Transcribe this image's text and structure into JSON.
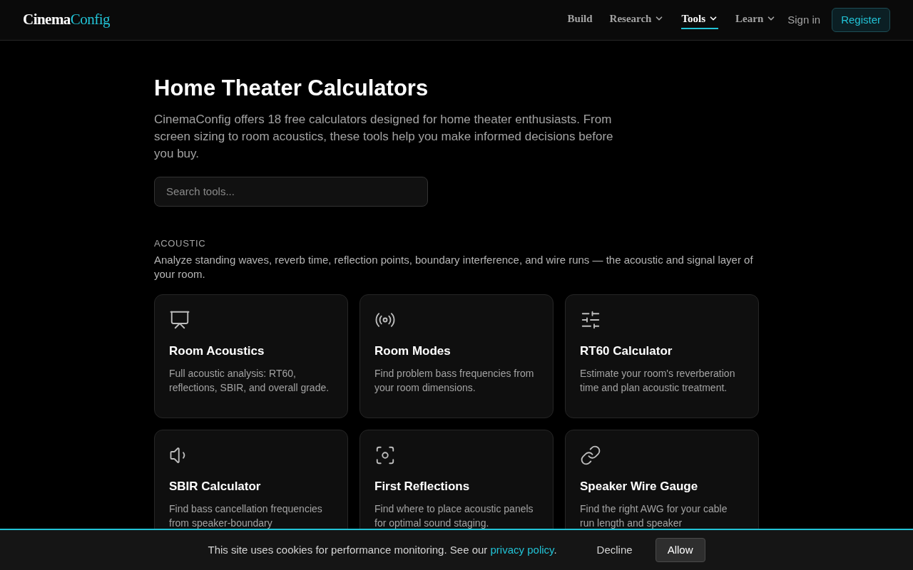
{
  "header": {
    "logo": {
      "part_1": "Cinema",
      "part_2": "Config"
    },
    "nav": [
      {
        "label": "Build",
        "dropdown": false,
        "selected": false
      },
      {
        "label": "Research",
        "dropdown": true,
        "selected": false
      },
      {
        "label": "Tools",
        "dropdown": true,
        "selected": true
      },
      {
        "label": "Learn",
        "dropdown": true,
        "selected": false
      }
    ],
    "sign_in": "Sign in",
    "register": "Register"
  },
  "title": "Home Theater Calculators",
  "intro": "CinemaConfig offers 18 free calculators designed for home theater enthusiasts. From screen sizing to room acoustics, these tools help you make informed decisions before you buy.",
  "search": {
    "placeholder": "Search tools..."
  },
  "section": {
    "heading": "ACOUSTIC",
    "description": "Analyze standing waves, reverb time, reflection points, boundary interference, and wire runs — the acoustic and signal layer of your room.",
    "cards": [
      {
        "title": "Room Acoustics",
        "text": "Full acoustic analysis: RT60, reflections, SBIR, and overall grade."
      },
      {
        "title": "Room Modes",
        "text": "Find problem bass frequencies from your room dimensions."
      },
      {
        "title": "RT60 Calculator",
        "text": "Estimate your room's reverberation time and plan acoustic treatment."
      },
      {
        "title": "SBIR Calculator",
        "text": "Find bass cancellation frequencies from speaker-boundary"
      },
      {
        "title": "First Reflections",
        "text": "Find where to place acoustic panels for optimal sound staging."
      },
      {
        "title": "Speaker Wire Gauge",
        "text": "Find the right AWG for your cable run length and speaker"
      }
    ]
  },
  "cookie": {
    "text": "This site uses cookies for performance monitoring. See our",
    "link": "privacy policy",
    "after": ".",
    "decline": "Decline",
    "allow": "Allow"
  }
}
